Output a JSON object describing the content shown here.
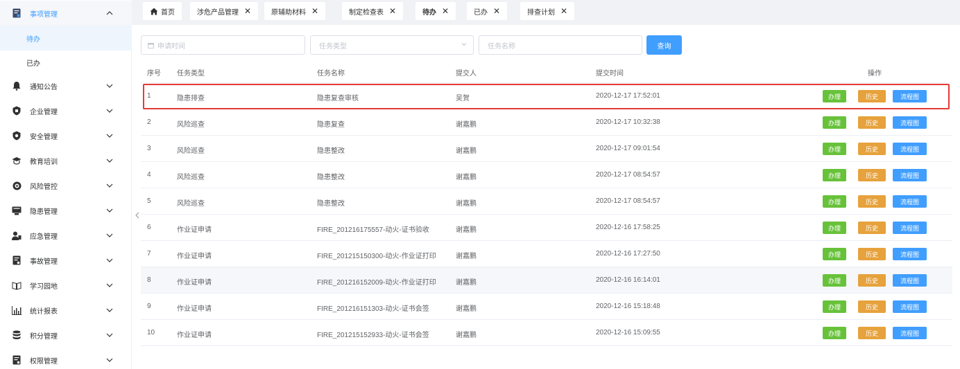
{
  "sidebar": {
    "menu": [
      {
        "label": "事项管理",
        "icon": "task-doc-icon",
        "expanded": true
      },
      {
        "label": "通知公告",
        "icon": "bell-icon"
      },
      {
        "label": "企业管理",
        "icon": "shield-company-icon"
      },
      {
        "label": "安全管理",
        "icon": "safety-shield-icon"
      },
      {
        "label": "教育培训",
        "icon": "graduation-cap-icon"
      },
      {
        "label": "风险管控",
        "icon": "risk-target-icon"
      },
      {
        "label": "隐患管理",
        "icon": "hazard-monitor-icon"
      },
      {
        "label": "应急管理",
        "icon": "emergency-person-icon"
      },
      {
        "label": "事故管理",
        "icon": "accident-doc-icon"
      },
      {
        "label": "学习园地",
        "icon": "study-book-icon"
      },
      {
        "label": "统计报表",
        "icon": "bar-chart-icon"
      },
      {
        "label": "积分管理",
        "icon": "database-icon"
      },
      {
        "label": "权限管理",
        "icon": "permission-doc-icon"
      }
    ],
    "submenu": [
      {
        "label": "待办",
        "active": true
      },
      {
        "label": "已办",
        "active": false
      }
    ]
  },
  "tabs": [
    {
      "label": "首页",
      "icon": "home-icon",
      "closable": false
    },
    {
      "label": "涉危产品管理",
      "closable": true
    },
    {
      "label": "原辅助材料",
      "closable": true
    },
    {
      "label": "制定检查表",
      "closable": true
    },
    {
      "label": "待办",
      "closable": true,
      "active": true
    },
    {
      "label": "已办",
      "closable": true
    },
    {
      "label": "排查计划",
      "closable": true
    }
  ],
  "search": {
    "date_placeholder": "申请时间",
    "type_placeholder": "任务类型",
    "name_placeholder": "任务名称",
    "query_label": "查询"
  },
  "table": {
    "headers": {
      "index": "序号",
      "type": "任务类型",
      "name": "任务名称",
      "submitter": "提交人",
      "time": "提交时间",
      "ops": "操作"
    },
    "rows": [
      {
        "index": "1",
        "type": "隐患排查",
        "name": "隐患复查审核",
        "submitter": "吴贺",
        "time": "2020-12-17 17:52:01"
      },
      {
        "index": "2",
        "type": "风险巡查",
        "name": "隐患复查",
        "submitter": "谢嘉鹏",
        "time": "2020-12-17 10:32:38"
      },
      {
        "index": "3",
        "type": "风险巡查",
        "name": "隐患整改",
        "submitter": "谢嘉鹏",
        "time": "2020-12-17 09:01:54"
      },
      {
        "index": "4",
        "type": "风险巡查",
        "name": "隐患整改",
        "submitter": "谢嘉鹏",
        "time": "2020-12-17 08:54:57"
      },
      {
        "index": "5",
        "type": "风险巡查",
        "name": "隐患整改",
        "submitter": "谢嘉鹏",
        "time": "2020-12-17 08:54:57"
      },
      {
        "index": "6",
        "type": "作业证申请",
        "name": "FIRE_201216175557-动火-证书验收",
        "submitter": "谢嘉鹏",
        "time": "2020-12-16 17:58:25"
      },
      {
        "index": "7",
        "type": "作业证申请",
        "name": "FIRE_201215150300-动火-作业证打印",
        "submitter": "谢嘉鹏",
        "time": "2020-12-16 17:27:50"
      },
      {
        "index": "8",
        "type": "作业证申请",
        "name": "FIRE_201216152009-动火-作业证打印",
        "submitter": "谢嘉鹏",
        "time": "2020-12-16 16:14:01"
      },
      {
        "index": "9",
        "type": "作业证申请",
        "name": "FIRE_201216151303-动火-证书会签",
        "submitter": "谢嘉鹏",
        "time": "2020-12-16 15:18:48"
      },
      {
        "index": "10",
        "type": "作业证申请",
        "name": "FIRE_201215152933-动火-证书会签",
        "submitter": "谢嘉鹏",
        "time": "2020-12-16 15:09:55"
      }
    ],
    "op_labels": {
      "handle": "办理",
      "history": "历史",
      "flow": "流程图"
    }
  },
  "colors": {
    "primary": "#409eff",
    "success": "#67c23a",
    "warning": "#e6a23c",
    "highlight_border": "#e53935"
  }
}
